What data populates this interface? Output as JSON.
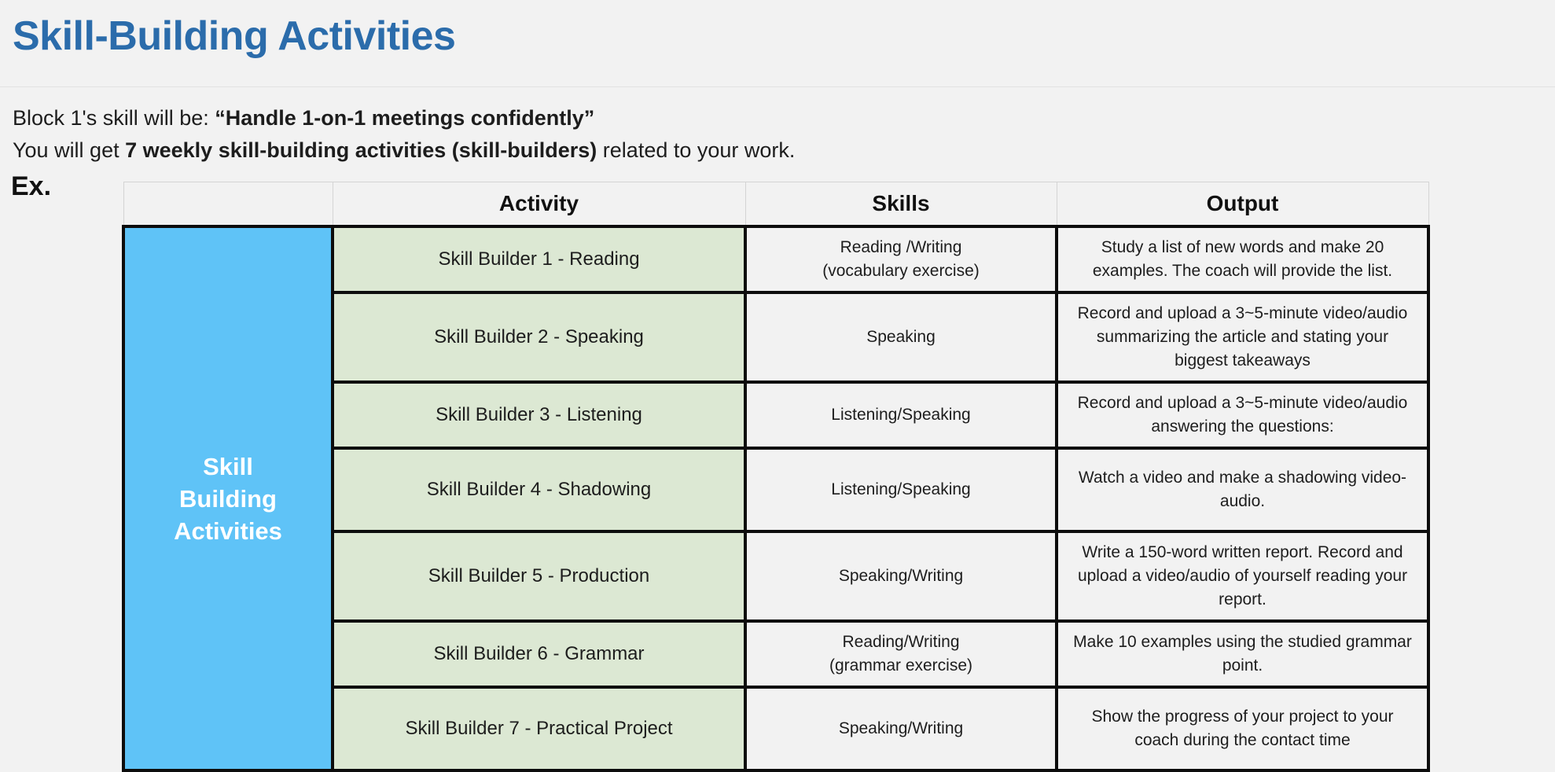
{
  "header": {
    "title": "Skill-Building Activities"
  },
  "intro": {
    "line1_prefix": "Block 1's skill will be: ",
    "line1_bold": "“Handle 1-on-1 meetings confidently”",
    "line2_prefix": "You will get ",
    "line2_bold": "7 weekly skill-building activities (skill-builders)",
    "line2_suffix": " related to your work.",
    "example_label": "Ex."
  },
  "table": {
    "columns": [
      "",
      "Activity",
      "Skills",
      "Output"
    ],
    "row_header_label": "Skill\nBuilding\nActivities",
    "row_header_line1": "Skill",
    "row_header_line2": "Building",
    "row_header_line3": "Activities",
    "rows": [
      {
        "activity": "Skill Builder 1 - Reading",
        "skills_line1": "Reading /Writing",
        "skills_line2": "(vocabulary exercise)",
        "output": "Study a list of new words and make 20 examples. The coach will provide the list."
      },
      {
        "activity": "Skill Builder 2 - Speaking",
        "skills_line1": "Speaking",
        "skills_line2": "",
        "output": "Record and upload a 3~5-minute video/audio summarizing the article and stating your biggest takeaways"
      },
      {
        "activity": "Skill Builder 3 - Listening",
        "skills_line1": "Listening/Speaking",
        "skills_line2": "",
        "output": "Record and upload a 3~5-minute video/audio answering the questions:"
      },
      {
        "activity": "Skill Builder 4 - Shadowing",
        "skills_line1": "Listening/Speaking",
        "skills_line2": "",
        "output": "Watch a video and make a shadowing video-audio."
      },
      {
        "activity": "Skill Builder 5 - Production",
        "skills_line1": "Speaking/Writing",
        "skills_line2": "",
        "output": "Write a 150-word written report. Record and upload a video/audio of yourself reading your report."
      },
      {
        "activity": "Skill Builder 6 - Grammar",
        "skills_line1": "Reading/Writing",
        "skills_line2": "(grammar exercise)",
        "output": "Make 10 examples using the studied grammar point."
      },
      {
        "activity": "Skill Builder 7 - Practical Project",
        "skills_line1": "Speaking/Writing",
        "skills_line2": "",
        "output": "Show the progress of your project to your coach during the contact time"
      }
    ]
  },
  "colors": {
    "title_blue": "#2b6cab",
    "row_header_blue": "#5fc3f7",
    "activity_green": "#dce8d3",
    "page_background": "#f2f2f2",
    "cell_border": "#0d0d0d"
  }
}
